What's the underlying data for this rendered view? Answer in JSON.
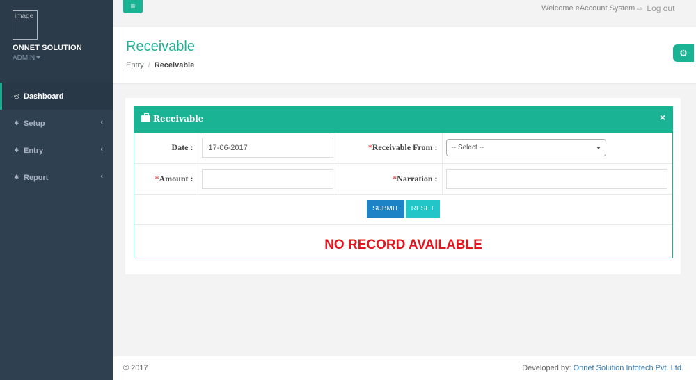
{
  "sidebar": {
    "avatar_alt": "image",
    "company": "ONNET SOLUTION",
    "role": "ADMIN",
    "items": [
      {
        "label": "Dashboard",
        "icon": "dashboard-icon"
      },
      {
        "label": "Setup",
        "icon": "gear-icon"
      },
      {
        "label": "Entry",
        "icon": "gear-icon"
      },
      {
        "label": "Report",
        "icon": "gear-icon"
      }
    ]
  },
  "topbar": {
    "menu_icon": "≡",
    "welcome": "Welcome eAccount System",
    "logout": "Log out"
  },
  "page": {
    "title": "Receivable",
    "breadcrumb": [
      "Entry",
      "Receivable"
    ]
  },
  "panel": {
    "title": "Receivable",
    "close": "×",
    "fields": {
      "date_label": "Date :",
      "date_value": "17-06-2017",
      "receivable_from_label": "Receivable From :",
      "receivable_from_selected": "-- Select --",
      "amount_label": "Amount :",
      "amount_value": "",
      "narration_label": "Narration :",
      "narration_value": "",
      "required_mark": "*"
    },
    "buttons": {
      "submit": "SUBMIT",
      "reset": "RESET"
    },
    "empty_message": "NO RECORD AVAILABLE"
  },
  "footer": {
    "copyright": "© 2017",
    "developed_by": "Developed by:",
    "developer": "Onnet Solution Infotech Pvt. Ltd."
  },
  "colors": {
    "sidebar_bg": "#2f4050",
    "accent": "#1ab394",
    "submit": "#1c84c6",
    "reset": "#23c6c8",
    "empty_message": "#e0161e"
  }
}
